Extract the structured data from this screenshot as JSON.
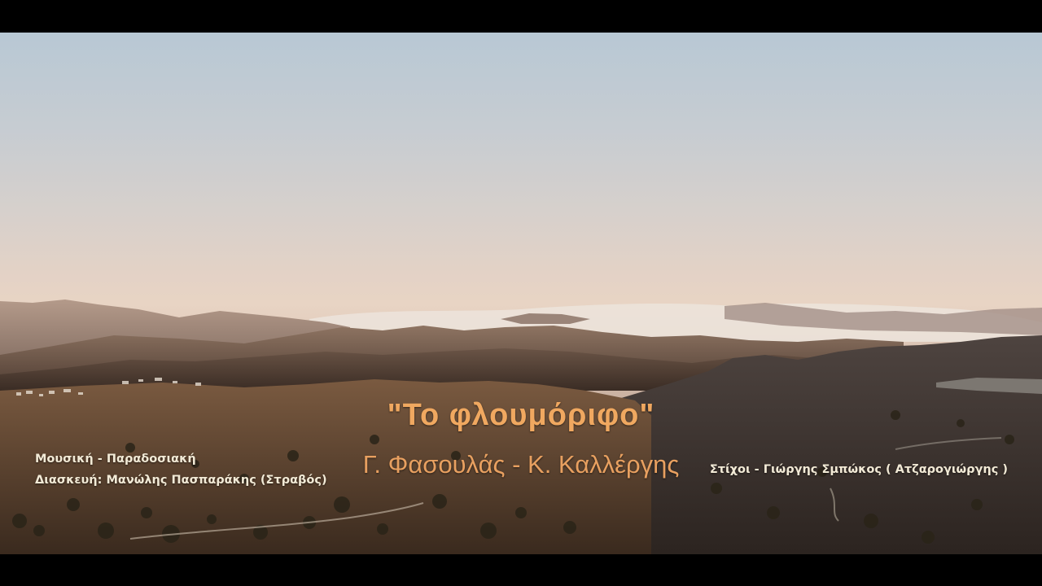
{
  "video": {
    "title": "\"Το φλουμόριφο\"",
    "performers": "Γ. Φασουλάς - Κ. Καλλέργης",
    "credits": {
      "music": "Μουσική - Παραδοσιακή",
      "arrangement": "Διασκευή: Μανώλης Πασπαράκης (Στραβός)",
      "lyrics": "Στίχοι - Γιώργης Σμπώκος ( Ατζαρογιώργης )"
    }
  },
  "colors": {
    "title": "#f0a860",
    "performers": "#e8a060",
    "credits": "#f2ead6",
    "sky_top": "#b8c8d4",
    "horizon": "#e8d4c4"
  }
}
